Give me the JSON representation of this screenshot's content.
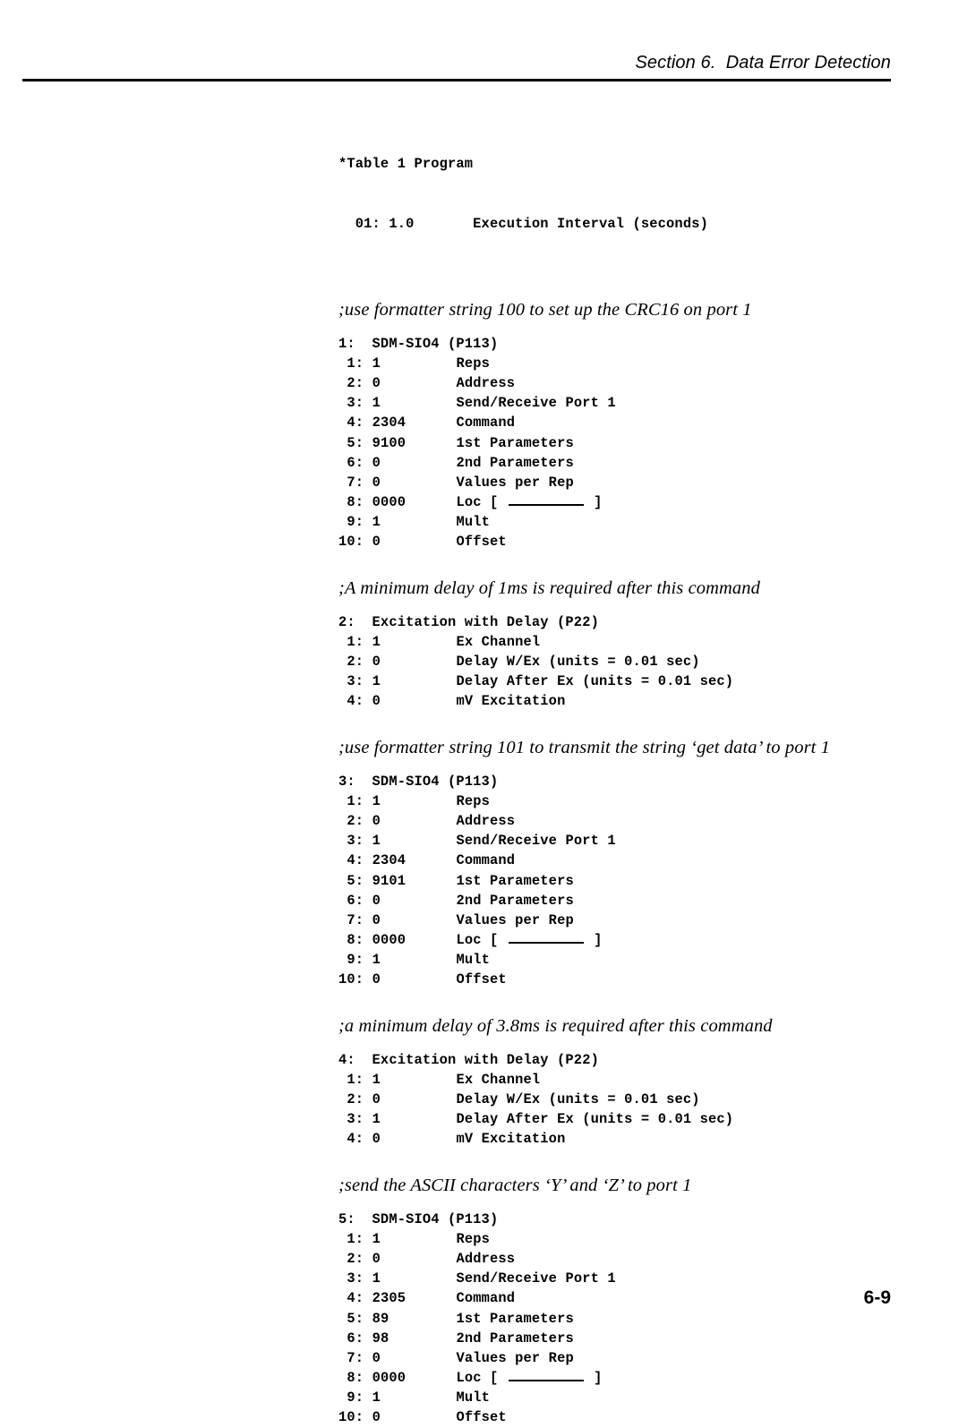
{
  "header": {
    "title": "Section 6.  Data Error Detection"
  },
  "footer": {
    "page_number": "6-9"
  },
  "program": {
    "table_header": "*Table 1 Program",
    "execution_line": "  01: 1.0       Execution Interval (seconds)"
  },
  "sections": [
    {
      "comment": ";use formatter string 100 to set up the CRC16 on port 1",
      "instruction_title": "1:  SDM-SIO4 (P113)",
      "params": [
        {
          "index": " 1:",
          "value": "1",
          "label": "Reps"
        },
        {
          "index": " 2:",
          "value": "0",
          "label": "Address"
        },
        {
          "index": " 3:",
          "value": "1",
          "label": "Send/Receive Port 1"
        },
        {
          "index": " 4:",
          "value": "2304",
          "label": "Command"
        },
        {
          "index": " 5:",
          "value": "9100",
          "label": "1st Parameters"
        },
        {
          "index": " 6:",
          "value": "0",
          "label": "2nd Parameters"
        },
        {
          "index": " 7:",
          "value": "0",
          "label": "Values per Rep"
        },
        {
          "index": " 8:",
          "value": "0000",
          "label": "Loc [ ________ ]"
        },
        {
          "index": " 9:",
          "value": "1",
          "label": "Mult"
        },
        {
          "index": "10:",
          "value": "0",
          "label": "Offset"
        }
      ]
    },
    {
      "comment": ";A minimum delay of 1ms is required after this command",
      "instruction_title": "2:  Excitation with Delay (P22)",
      "params": [
        {
          "index": " 1:",
          "value": "1",
          "label": "Ex Channel"
        },
        {
          "index": " 2:",
          "value": "0",
          "label": "Delay W/Ex (units = 0.01 sec)"
        },
        {
          "index": " 3:",
          "value": "1",
          "label": "Delay After Ex (units = 0.01 sec)"
        },
        {
          "index": " 4:",
          "value": "0",
          "label": "mV Excitation"
        }
      ]
    },
    {
      "comment": ";use formatter string 101 to transmit the string ‘get data’ to port 1",
      "instruction_title": "3:  SDM-SIO4 (P113)",
      "params": [
        {
          "index": " 1:",
          "value": "1",
          "label": "Reps"
        },
        {
          "index": " 2:",
          "value": "0",
          "label": "Address"
        },
        {
          "index": " 3:",
          "value": "1",
          "label": "Send/Receive Port 1"
        },
        {
          "index": " 4:",
          "value": "2304",
          "label": "Command"
        },
        {
          "index": " 5:",
          "value": "9101",
          "label": "1st Parameters"
        },
        {
          "index": " 6:",
          "value": "0",
          "label": "2nd Parameters"
        },
        {
          "index": " 7:",
          "value": "0",
          "label": "Values per Rep"
        },
        {
          "index": " 8:",
          "value": "0000",
          "label": "Loc [ ________ ]"
        },
        {
          "index": " 9:",
          "value": "1",
          "label": "Mult"
        },
        {
          "index": "10:",
          "value": "0",
          "label": "Offset"
        }
      ]
    },
    {
      "comment": ";a minimum delay of 3.8ms is required after this command",
      "instruction_title": "4:  Excitation with Delay (P22)",
      "params": [
        {
          "index": " 1:",
          "value": "1",
          "label": "Ex Channel"
        },
        {
          "index": " 2:",
          "value": "0",
          "label": "Delay W/Ex (units = 0.01 sec)"
        },
        {
          "index": " 3:",
          "value": "1",
          "label": "Delay After Ex (units = 0.01 sec)"
        },
        {
          "index": " 4:",
          "value": "0",
          "label": "mV Excitation"
        }
      ]
    },
    {
      "comment": ";send the ASCII characters ‘Y’ and ‘Z’ to port 1",
      "instruction_title": "5:  SDM-SIO4 (P113)",
      "params": [
        {
          "index": " 1:",
          "value": "1",
          "label": "Reps"
        },
        {
          "index": " 2:",
          "value": "0",
          "label": "Address"
        },
        {
          "index": " 3:",
          "value": "1",
          "label": "Send/Receive Port 1"
        },
        {
          "index": " 4:",
          "value": "2305",
          "label": "Command"
        },
        {
          "index": " 5:",
          "value": "89",
          "label": "1st Parameters"
        },
        {
          "index": " 6:",
          "value": "98",
          "label": "2nd Parameters"
        },
        {
          "index": " 7:",
          "value": "0",
          "label": "Values per Rep"
        },
        {
          "index": " 8:",
          "value": "0000",
          "label": "Loc [ ________ ]"
        },
        {
          "index": " 9:",
          "value": "1",
          "label": "Mult"
        },
        {
          "index": "10:",
          "value": "0",
          "label": "Offset"
        }
      ]
    }
  ]
}
